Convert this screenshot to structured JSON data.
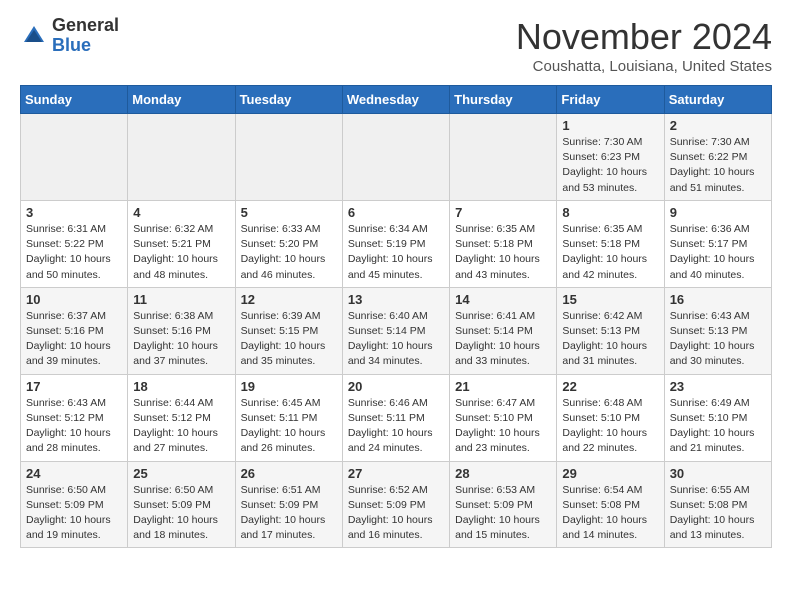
{
  "logo": {
    "general": "General",
    "blue": "Blue"
  },
  "header": {
    "month": "November 2024",
    "location": "Coushatta, Louisiana, United States"
  },
  "weekdays": [
    "Sunday",
    "Monday",
    "Tuesday",
    "Wednesday",
    "Thursday",
    "Friday",
    "Saturday"
  ],
  "weeks": [
    [
      {
        "day": "",
        "info": ""
      },
      {
        "day": "",
        "info": ""
      },
      {
        "day": "",
        "info": ""
      },
      {
        "day": "",
        "info": ""
      },
      {
        "day": "",
        "info": ""
      },
      {
        "day": "1",
        "info": "Sunrise: 7:30 AM\nSunset: 6:23 PM\nDaylight: 10 hours\nand 53 minutes."
      },
      {
        "day": "2",
        "info": "Sunrise: 7:30 AM\nSunset: 6:22 PM\nDaylight: 10 hours\nand 51 minutes."
      }
    ],
    [
      {
        "day": "3",
        "info": "Sunrise: 6:31 AM\nSunset: 5:22 PM\nDaylight: 10 hours\nand 50 minutes."
      },
      {
        "day": "4",
        "info": "Sunrise: 6:32 AM\nSunset: 5:21 PM\nDaylight: 10 hours\nand 48 minutes."
      },
      {
        "day": "5",
        "info": "Sunrise: 6:33 AM\nSunset: 5:20 PM\nDaylight: 10 hours\nand 46 minutes."
      },
      {
        "day": "6",
        "info": "Sunrise: 6:34 AM\nSunset: 5:19 PM\nDaylight: 10 hours\nand 45 minutes."
      },
      {
        "day": "7",
        "info": "Sunrise: 6:35 AM\nSunset: 5:18 PM\nDaylight: 10 hours\nand 43 minutes."
      },
      {
        "day": "8",
        "info": "Sunrise: 6:35 AM\nSunset: 5:18 PM\nDaylight: 10 hours\nand 42 minutes."
      },
      {
        "day": "9",
        "info": "Sunrise: 6:36 AM\nSunset: 5:17 PM\nDaylight: 10 hours\nand 40 minutes."
      }
    ],
    [
      {
        "day": "10",
        "info": "Sunrise: 6:37 AM\nSunset: 5:16 PM\nDaylight: 10 hours\nand 39 minutes."
      },
      {
        "day": "11",
        "info": "Sunrise: 6:38 AM\nSunset: 5:16 PM\nDaylight: 10 hours\nand 37 minutes."
      },
      {
        "day": "12",
        "info": "Sunrise: 6:39 AM\nSunset: 5:15 PM\nDaylight: 10 hours\nand 35 minutes."
      },
      {
        "day": "13",
        "info": "Sunrise: 6:40 AM\nSunset: 5:14 PM\nDaylight: 10 hours\nand 34 minutes."
      },
      {
        "day": "14",
        "info": "Sunrise: 6:41 AM\nSunset: 5:14 PM\nDaylight: 10 hours\nand 33 minutes."
      },
      {
        "day": "15",
        "info": "Sunrise: 6:42 AM\nSunset: 5:13 PM\nDaylight: 10 hours\nand 31 minutes."
      },
      {
        "day": "16",
        "info": "Sunrise: 6:43 AM\nSunset: 5:13 PM\nDaylight: 10 hours\nand 30 minutes."
      }
    ],
    [
      {
        "day": "17",
        "info": "Sunrise: 6:43 AM\nSunset: 5:12 PM\nDaylight: 10 hours\nand 28 minutes."
      },
      {
        "day": "18",
        "info": "Sunrise: 6:44 AM\nSunset: 5:12 PM\nDaylight: 10 hours\nand 27 minutes."
      },
      {
        "day": "19",
        "info": "Sunrise: 6:45 AM\nSunset: 5:11 PM\nDaylight: 10 hours\nand 26 minutes."
      },
      {
        "day": "20",
        "info": "Sunrise: 6:46 AM\nSunset: 5:11 PM\nDaylight: 10 hours\nand 24 minutes."
      },
      {
        "day": "21",
        "info": "Sunrise: 6:47 AM\nSunset: 5:10 PM\nDaylight: 10 hours\nand 23 minutes."
      },
      {
        "day": "22",
        "info": "Sunrise: 6:48 AM\nSunset: 5:10 PM\nDaylight: 10 hours\nand 22 minutes."
      },
      {
        "day": "23",
        "info": "Sunrise: 6:49 AM\nSunset: 5:10 PM\nDaylight: 10 hours\nand 21 minutes."
      }
    ],
    [
      {
        "day": "24",
        "info": "Sunrise: 6:50 AM\nSunset: 5:09 PM\nDaylight: 10 hours\nand 19 minutes."
      },
      {
        "day": "25",
        "info": "Sunrise: 6:50 AM\nSunset: 5:09 PM\nDaylight: 10 hours\nand 18 minutes."
      },
      {
        "day": "26",
        "info": "Sunrise: 6:51 AM\nSunset: 5:09 PM\nDaylight: 10 hours\nand 17 minutes."
      },
      {
        "day": "27",
        "info": "Sunrise: 6:52 AM\nSunset: 5:09 PM\nDaylight: 10 hours\nand 16 minutes."
      },
      {
        "day": "28",
        "info": "Sunrise: 6:53 AM\nSunset: 5:09 PM\nDaylight: 10 hours\nand 15 minutes."
      },
      {
        "day": "29",
        "info": "Sunrise: 6:54 AM\nSunset: 5:08 PM\nDaylight: 10 hours\nand 14 minutes."
      },
      {
        "day": "30",
        "info": "Sunrise: 6:55 AM\nSunset: 5:08 PM\nDaylight: 10 hours\nand 13 minutes."
      }
    ]
  ]
}
